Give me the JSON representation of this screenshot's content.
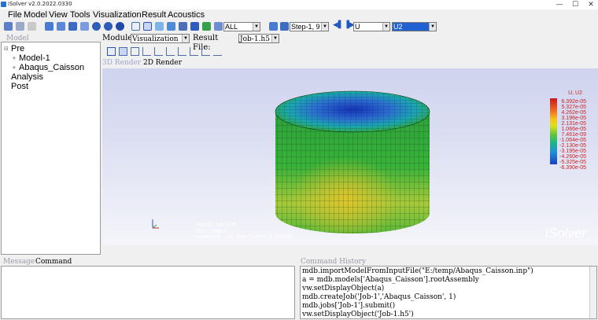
{
  "window": {
    "title": "iSolver v2.0.2022.0330",
    "minimize": "—",
    "maximize": "☐",
    "close": "✕"
  },
  "menu": [
    "File",
    "Model",
    "View",
    "Tools",
    "Visualization",
    "Result",
    "Acoustics"
  ],
  "toolbar": {
    "filter_value": "ALL",
    "step_value": "Step-1, 9",
    "field_value": "U",
    "component_value": "U2"
  },
  "model_panel": {
    "header": "Model",
    "tree": [
      {
        "label": "Pre",
        "expand": "⊟"
      },
      {
        "label": "Model-1",
        "expand": "+"
      },
      {
        "label": "Abaqus_Caisson",
        "expand": "+"
      },
      {
        "label": "Analysis",
        "expand": ""
      },
      {
        "label": "Post",
        "expand": ""
      }
    ]
  },
  "module_bar": {
    "module_label": "Module:",
    "module_value": "Visualization",
    "result_label": "Result File:",
    "result_value": "Job-1.h5"
  },
  "render_tabs": {
    "tab3d": "3D Render",
    "tab2d": "2D Render"
  },
  "legend": {
    "title": "U, U2",
    "values": [
      "6.392e-05",
      "5.327e-05",
      "4.262e-05",
      "3.196e-05",
      "2.131e-05",
      "1.066e-05",
      "7.461e-09",
      "-1.064e-05",
      "-2.130e-05",
      "-3.195e-05",
      "-4.260e-05",
      "-5.325e-05",
      "-6.390e-05"
    ]
  },
  "result_info": {
    "line1": "Result: Job-1.h5",
    "line2": "Step: Step-1,",
    "line3": "Increment    10: Step Time =   1.000000"
  },
  "brand": "iSolver",
  "bottom": {
    "message_tab": "Message",
    "command_tab": "Command",
    "history_header": "Command History",
    "history": [
      "mdb.importModelFromInputFile(\"E:/temp/Abaqus_Caisson.inp\")",
      "a = mdb.models['Abaqus_Caisson'].rootAssembly",
      "vw.setDisplayObject(a)",
      "mdb.createJob('Job-1','Abaqus_Caisson', 1)",
      "mdb.jobs['Job-1'].submit()",
      "vw.setDisplayObject('Job-1.h5')"
    ]
  },
  "colors": {
    "accent": "#2a6fd6",
    "selection": "#2060d0",
    "viewport_top": "#cfd3ee",
    "legend_text": "#cc2222"
  }
}
